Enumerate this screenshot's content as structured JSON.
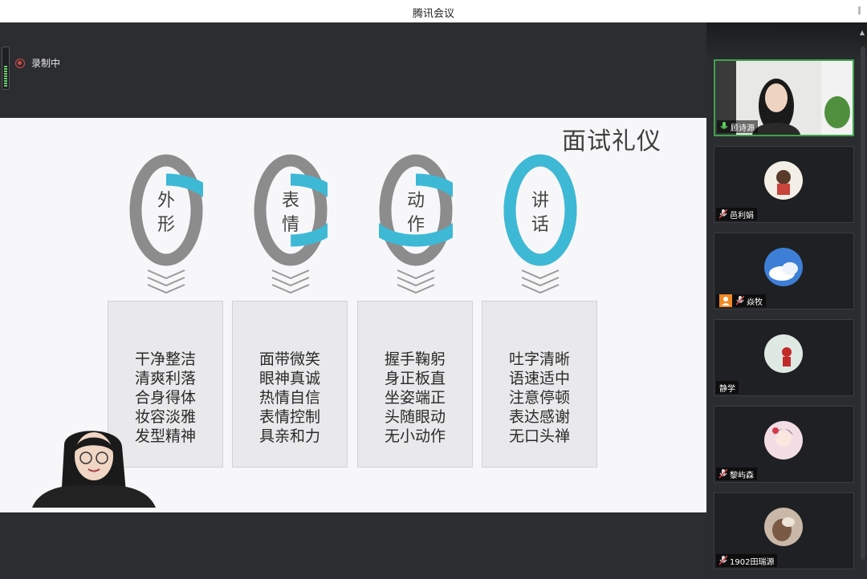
{
  "app": {
    "title": "腾讯会议"
  },
  "recording": {
    "label": "录制中"
  },
  "slide": {
    "title": "面试礼仪",
    "colors": {
      "accent": "#3db9d6",
      "gray": "#8c8c8c"
    },
    "topics": [
      {
        "chars": [
          "外",
          "形"
        ],
        "fill": 0.25,
        "items": [
          "干净整洁",
          "清爽利落",
          "合身得体",
          "妆容淡雅",
          "发型精神"
        ]
      },
      {
        "chars": [
          "表",
          "情"
        ],
        "fill": 0.5,
        "items": [
          "面带微笑",
          "眼神真诚",
          "热情自信",
          "表情控制",
          "具亲和力"
        ]
      },
      {
        "chars": [
          "动",
          "作"
        ],
        "fill": 0.75,
        "items": [
          "握手鞠躬",
          "身正板直",
          "坐姿端正",
          "头随眼动",
          "无小动作"
        ]
      },
      {
        "chars": [
          "讲",
          "话"
        ],
        "fill": 1.0,
        "items": [
          "吐字清晰",
          "语速适中",
          "注意停顿",
          "表达感谢",
          "无口头禅"
        ]
      }
    ]
  },
  "participants": [
    {
      "name": "顾诗源",
      "mic": "active",
      "video": true
    },
    {
      "name": "邑利娟",
      "mic": "muted"
    },
    {
      "name": "焱牧",
      "mic": "muted",
      "badge": "person-icon"
    },
    {
      "name": "静学",
      "mic": "none"
    },
    {
      "name": "黎屿森",
      "mic": "muted"
    },
    {
      "name": "1902田瑞源",
      "mic": "muted"
    }
  ]
}
